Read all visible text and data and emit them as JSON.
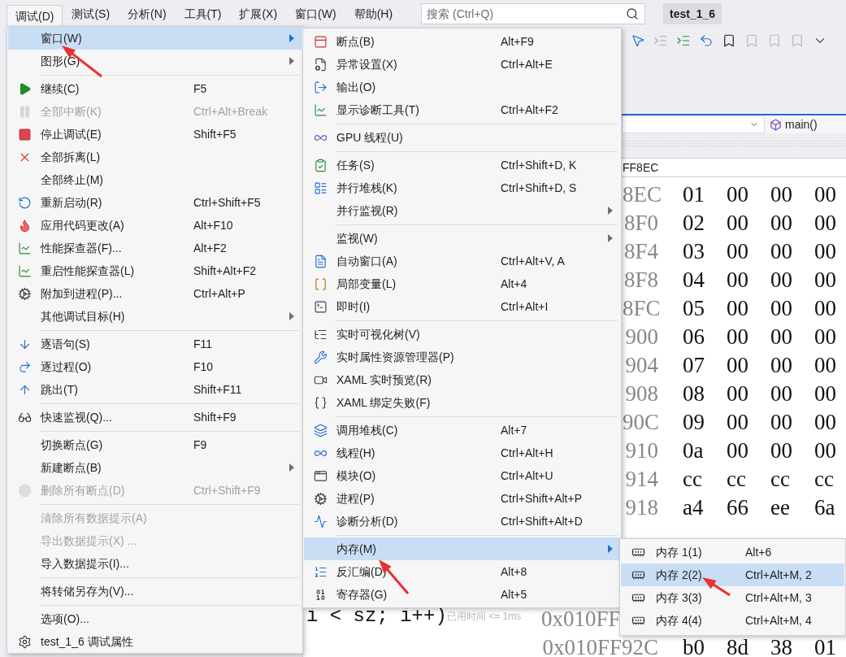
{
  "menubar": [
    {
      "label": "调试(D)",
      "selected": true
    },
    {
      "label": "测试(S)",
      "selected": false
    },
    {
      "label": "分析(N)",
      "selected": false
    },
    {
      "label": "工具(T)",
      "selected": false
    },
    {
      "label": "扩展(X)",
      "selected": false
    },
    {
      "label": "窗口(W)",
      "selected": false
    },
    {
      "label": "帮助(H)",
      "selected": false
    }
  ],
  "search": {
    "placeholder": "搜索 (Ctrl+Q)"
  },
  "solution_title": "test_1_6",
  "debug_menu": {
    "items": [
      {
        "kind": "item",
        "label": "窗口(W)",
        "submenu": true,
        "selected": true,
        "disabled": false
      },
      {
        "kind": "item",
        "label": "图形(G)",
        "submenu": true,
        "selected": false,
        "disabled": false
      },
      {
        "kind": "separator"
      },
      {
        "kind": "item",
        "label": "继续(C)",
        "shortcut": "F5",
        "submenu": false,
        "selected": false,
        "disabled": false
      },
      {
        "kind": "item",
        "label": "全部中断(K)",
        "shortcut": "Ctrl+Alt+Break",
        "submenu": false,
        "selected": false,
        "disabled": true
      },
      {
        "kind": "item",
        "label": "停止调试(E)",
        "shortcut": "Shift+F5",
        "submenu": false,
        "selected": false,
        "disabled": false
      },
      {
        "kind": "item",
        "label": "全部拆离(L)",
        "submenu": false,
        "selected": false,
        "disabled": false
      },
      {
        "kind": "item",
        "label": "全部终止(M)",
        "submenu": false,
        "selected": false,
        "disabled": false
      },
      {
        "kind": "item",
        "label": "重新启动(R)",
        "shortcut": "Ctrl+Shift+F5",
        "submenu": false,
        "selected": false,
        "disabled": false
      },
      {
        "kind": "item",
        "label": "应用代码更改(A)",
        "shortcut": "Alt+F10",
        "submenu": false,
        "selected": false,
        "disabled": false
      },
      {
        "kind": "item",
        "label": "性能探查器(F)...",
        "shortcut": "Alt+F2",
        "submenu": false,
        "selected": false,
        "disabled": false
      },
      {
        "kind": "item",
        "label": "重启性能探查器(L)",
        "shortcut": "Shift+Alt+F2",
        "submenu": false,
        "selected": false,
        "disabled": false
      },
      {
        "kind": "item",
        "label": "附加到进程(P)...",
        "shortcut": "Ctrl+Alt+P",
        "submenu": false,
        "selected": false,
        "disabled": false
      },
      {
        "kind": "item",
        "label": "其他调试目标(H)",
        "submenu": true,
        "selected": false,
        "disabled": false
      },
      {
        "kind": "separator"
      },
      {
        "kind": "item",
        "label": "逐语句(S)",
        "shortcut": "F11",
        "submenu": false,
        "selected": false,
        "disabled": false
      },
      {
        "kind": "item",
        "label": "逐过程(O)",
        "shortcut": "F10",
        "submenu": false,
        "selected": false,
        "disabled": false
      },
      {
        "kind": "item",
        "label": "跳出(T)",
        "shortcut": "Shift+F11",
        "submenu": false,
        "selected": false,
        "disabled": false
      },
      {
        "kind": "separator"
      },
      {
        "kind": "item",
        "label": "快速监视(Q)...",
        "shortcut": "Shift+F9",
        "submenu": false,
        "selected": false,
        "disabled": false
      },
      {
        "kind": "separator"
      },
      {
        "kind": "item",
        "label": "切换断点(G)",
        "shortcut": "F9",
        "submenu": false,
        "selected": false,
        "disabled": false
      },
      {
        "kind": "item",
        "label": "新建断点(B)",
        "submenu": true,
        "selected": false,
        "disabled": false
      },
      {
        "kind": "item",
        "label": "删除所有断点(D)",
        "shortcut": "Ctrl+Shift+F9",
        "submenu": false,
        "selected": false,
        "disabled": true
      },
      {
        "kind": "separator"
      },
      {
        "kind": "item",
        "label": "清除所有数据提示(A)",
        "submenu": false,
        "selected": false,
        "disabled": true
      },
      {
        "kind": "item",
        "label": "导出数据提示(X) ...",
        "submenu": false,
        "selected": false,
        "disabled": true
      },
      {
        "kind": "item",
        "label": "导入数据提示(I)...",
        "submenu": false,
        "selected": false,
        "disabled": false
      },
      {
        "kind": "separator"
      },
      {
        "kind": "item",
        "label": "将转储另存为(V)...",
        "submenu": false,
        "selected": false,
        "disabled": false
      },
      {
        "kind": "separator"
      },
      {
        "kind": "item",
        "label": "选项(O)...",
        "submenu": false,
        "selected": false,
        "disabled": false
      },
      {
        "kind": "item",
        "label": "test_1_6 调试属性",
        "submenu": false,
        "selected": false,
        "disabled": false
      }
    ]
  },
  "window_submenu": {
    "items": [
      {
        "kind": "item",
        "label": "断点(B)",
        "shortcut": "Alt+F9",
        "submenu": false,
        "selected": false,
        "disabled": false
      },
      {
        "kind": "item",
        "label": "异常设置(X)",
        "shortcut": "Ctrl+Alt+E",
        "submenu": false,
        "selected": false,
        "disabled": false
      },
      {
        "kind": "item",
        "label": "输出(O)",
        "submenu": false,
        "selected": false,
        "disabled": false
      },
      {
        "kind": "item",
        "label": "显示诊断工具(T)",
        "shortcut": "Ctrl+Alt+F2",
        "submenu": false,
        "selected": false,
        "disabled": false
      },
      {
        "kind": "separator"
      },
      {
        "kind": "item",
        "label": "GPU 线程(U)",
        "submenu": false,
        "selected": false,
        "disabled": false
      },
      {
        "kind": "separator"
      },
      {
        "kind": "item",
        "label": "任务(S)",
        "shortcut": "Ctrl+Shift+D, K",
        "submenu": false,
        "selected": false,
        "disabled": false
      },
      {
        "kind": "item",
        "label": "并行堆栈(K)",
        "shortcut": "Ctrl+Shift+D, S",
        "submenu": false,
        "selected": false,
        "disabled": false
      },
      {
        "kind": "item",
        "label": "并行监视(R)",
        "submenu": true,
        "selected": false,
        "disabled": false
      },
      {
        "kind": "separator"
      },
      {
        "kind": "item",
        "label": "监视(W)",
        "submenu": true,
        "selected": false,
        "disabled": false
      },
      {
        "kind": "item",
        "label": "自动窗口(A)",
        "shortcut": "Ctrl+Alt+V, A",
        "submenu": false,
        "selected": false,
        "disabled": false
      },
      {
        "kind": "item",
        "label": "局部变量(L)",
        "shortcut": "Alt+4",
        "submenu": false,
        "selected": false,
        "disabled": false
      },
      {
        "kind": "item",
        "label": "即时(I)",
        "shortcut": "Ctrl+Alt+I",
        "submenu": false,
        "selected": false,
        "disabled": false
      },
      {
        "kind": "separator"
      },
      {
        "kind": "item",
        "label": "实时可视化树(V)",
        "submenu": false,
        "selected": false,
        "disabled": false
      },
      {
        "kind": "item",
        "label": "实时属性资源管理器(P)",
        "submenu": false,
        "selected": false,
        "disabled": false
      },
      {
        "kind": "item",
        "label": "XAML 实时预览(R)",
        "submenu": false,
        "selected": false,
        "disabled": false
      },
      {
        "kind": "item",
        "label": "XAML 绑定失败(F)",
        "submenu": false,
        "selected": false,
        "disabled": false
      },
      {
        "kind": "separator"
      },
      {
        "kind": "item",
        "label": "调用堆栈(C)",
        "shortcut": "Alt+7",
        "submenu": false,
        "selected": false,
        "disabled": false
      },
      {
        "kind": "item",
        "label": "线程(H)",
        "shortcut": "Ctrl+Alt+H",
        "submenu": false,
        "selected": false,
        "disabled": false
      },
      {
        "kind": "item",
        "label": "模块(O)",
        "shortcut": "Ctrl+Alt+U",
        "submenu": false,
        "selected": false,
        "disabled": false
      },
      {
        "kind": "item",
        "label": "进程(P)",
        "shortcut": "Ctrl+Shift+Alt+P",
        "submenu": false,
        "selected": false,
        "disabled": false
      },
      {
        "kind": "item",
        "label": "诊断分析(D)",
        "shortcut": "Ctrl+Shift+Alt+D",
        "submenu": false,
        "selected": false,
        "disabled": false
      },
      {
        "kind": "separator"
      },
      {
        "kind": "item",
        "label": "内存(M)",
        "submenu": true,
        "selected": true,
        "disabled": false
      },
      {
        "kind": "item",
        "label": "反汇编(D)",
        "shortcut": "Alt+8",
        "submenu": false,
        "selected": false,
        "disabled": false
      },
      {
        "kind": "item",
        "label": "寄存器(G)",
        "shortcut": "Alt+5",
        "submenu": false,
        "selected": false,
        "disabled": false
      }
    ]
  },
  "memory_submenu": {
    "items": [
      {
        "kind": "item",
        "label": "内存 1(1)",
        "shortcut": "Alt+6",
        "submenu": false,
        "selected": false,
        "disabled": false
      },
      {
        "kind": "item",
        "label": "内存 2(2)",
        "shortcut": "Ctrl+Alt+M, 2",
        "submenu": false,
        "selected": true,
        "disabled": false
      },
      {
        "kind": "item",
        "label": "内存 3(3)",
        "shortcut": "Ctrl+Alt+M, 3",
        "submenu": false,
        "selected": false,
        "disabled": false
      },
      {
        "kind": "item",
        "label": "内存 4(4)",
        "shortcut": "Ctrl+Alt+M, 4",
        "submenu": false,
        "selected": false,
        "disabled": false
      }
    ]
  },
  "navigation": {
    "function": "main()"
  },
  "memory_window": {
    "address": "FF8EC",
    "rows": [
      {
        "address": "8EC",
        "bytes": [
          "01",
          "00",
          "00",
          "00"
        ]
      },
      {
        "address": "8F0",
        "bytes": [
          "02",
          "00",
          "00",
          "00"
        ]
      },
      {
        "address": "8F4",
        "bytes": [
          "03",
          "00",
          "00",
          "00"
        ]
      },
      {
        "address": "8F8",
        "bytes": [
          "04",
          "00",
          "00",
          "00"
        ]
      },
      {
        "address": "8FC",
        "bytes": [
          "05",
          "00",
          "00",
          "00"
        ]
      },
      {
        "address": "900",
        "bytes": [
          "06",
          "00",
          "00",
          "00"
        ]
      },
      {
        "address": "904",
        "bytes": [
          "07",
          "00",
          "00",
          "00"
        ]
      },
      {
        "address": "908",
        "bytes": [
          "08",
          "00",
          "00",
          "00"
        ]
      },
      {
        "address": "90C",
        "bytes": [
          "09",
          "00",
          "00",
          "00"
        ]
      },
      {
        "address": "910",
        "bytes": [
          "0a",
          "00",
          "00",
          "00"
        ]
      },
      {
        "address": "914",
        "bytes": [
          "cc",
          "cc",
          "cc",
          "cc"
        ]
      },
      {
        "address": "918",
        "bytes": [
          "a4",
          "66",
          "ee",
          "6a"
        ]
      }
    ],
    "lower_rows": [
      {
        "address": "0x010FF"
      },
      {
        "address": "0x010FF92C",
        "bytes": [
          "b0",
          "8d",
          "38",
          "01"
        ]
      }
    ]
  },
  "editor": {
    "code": "i < sz; i++)",
    "hint": "已用时间 <= 1ms"
  }
}
